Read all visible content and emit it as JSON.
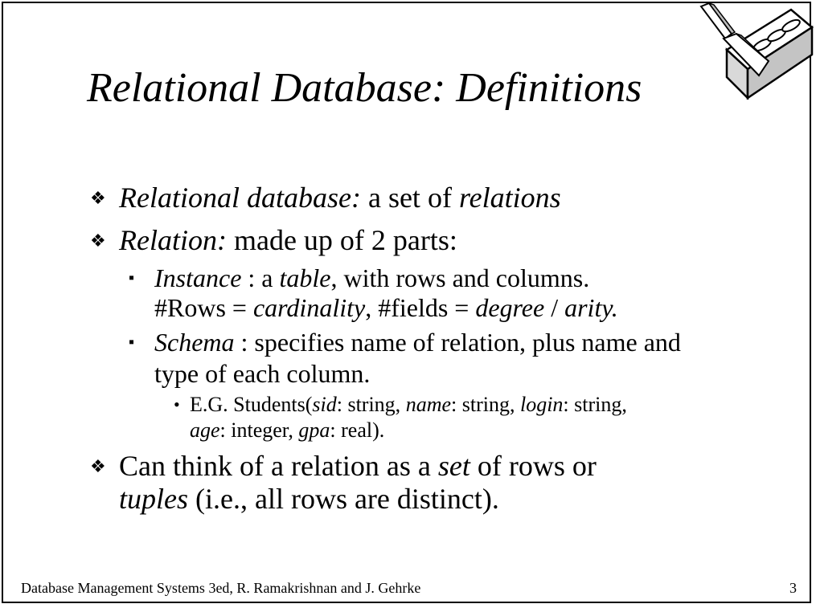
{
  "slide": {
    "title": "Relational Database: Definitions",
    "logo_icon": "brick-and-trowel-icon",
    "bullets": {
      "b1": {
        "term": "Relational database:",
        "text": " a set of ",
        "emph": "relations"
      },
      "b2": {
        "term": "Relation:",
        "text": " made up of 2 parts:"
      },
      "sub1": {
        "line1_term": "Instance",
        "line1_a": " : a ",
        "line1_table": "table",
        "line1_b": ", with rows and columns.",
        "line2_a": "#Rows = ",
        "line2_card": "cardinality",
        "line2_b": ", #fields = ",
        "line2_degree": "degree",
        "line2_c": " / ",
        "line2_arity": "arity."
      },
      "sub2": {
        "line1_term": "Schema",
        "line1_a": " : specifies name of relation, plus name and",
        "line2": "type of each column."
      },
      "sub3": {
        "line1_a": "E.G. Students(",
        "sid": "sid",
        "line1_b": ": string, ",
        "name": "name",
        "line1_c": ": string, ",
        "login": "login",
        "line1_d": ": string,",
        "age": "age",
        "line2_a": ": integer, ",
        "gpa": "gpa",
        "line2_b": ": real)."
      },
      "b3": {
        "line1_a": "Can think of a relation as a ",
        "line1_set": "set",
        "line1_b": " of rows or",
        "line2_tuples": "tuples",
        "line2_b": " (i.e., all rows are distinct)."
      }
    },
    "bullet_glyphs": {
      "level1": "❖",
      "level2": "▪",
      "level3": "•"
    },
    "footer": "Database Management Systems 3ed,  R. Ramakrishnan and J. Gehrke",
    "page_number": "3"
  }
}
